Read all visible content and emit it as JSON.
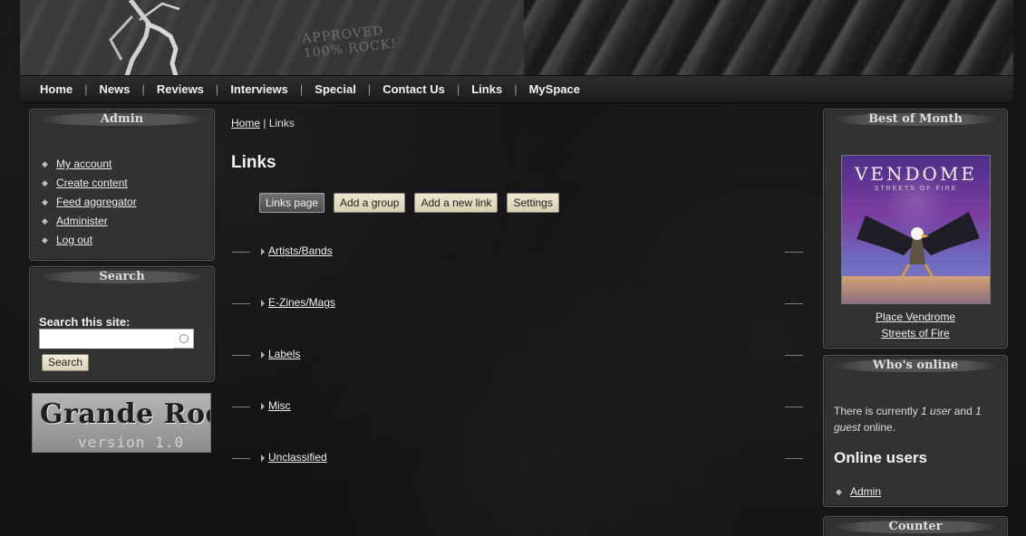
{
  "header": {
    "stamp_line_1": "Approved",
    "stamp_line_2": "100% Rock!"
  },
  "nav": [
    {
      "label": "Home"
    },
    {
      "label": "News"
    },
    {
      "label": "Reviews"
    },
    {
      "label": "Interviews"
    },
    {
      "label": "Special"
    },
    {
      "label": "Contact Us"
    },
    {
      "label": "Links"
    },
    {
      "label": "MySpace"
    }
  ],
  "admin": {
    "title": "Admin",
    "items": [
      {
        "label": "My account"
      },
      {
        "label": "Create content"
      },
      {
        "label": "Feed aggregator"
      },
      {
        "label": "Administer"
      },
      {
        "label": "Log out"
      }
    ]
  },
  "search": {
    "title": "Search",
    "label": "Search this site:",
    "value": "",
    "button_label": "Search"
  },
  "logo": {
    "main": "Grande Rock",
    "version": "version 1.0"
  },
  "main": {
    "breadcrumb": {
      "home": "Home",
      "separator": "|",
      "current": "Links"
    },
    "title": "Links",
    "tabs": [
      {
        "label": "Links page"
      },
      {
        "label": "Add a group"
      },
      {
        "label": "Add a new link"
      },
      {
        "label": "Settings"
      }
    ],
    "groups": [
      {
        "label": "Artists/Bands"
      },
      {
        "label": "E-Zines/Mags"
      },
      {
        "label": "Labels"
      },
      {
        "label": "Misc"
      },
      {
        "label": "Unclassified"
      }
    ]
  },
  "best_of_month": {
    "title": "Best of Month",
    "cover_title": "VENDOME",
    "cover_subtitle": "STREETS OF FIRE",
    "caption_line_1": "Place Vendrome",
    "caption_line_2": "Streets of Fire"
  },
  "online": {
    "title": "Who's online",
    "text_before_users": "There is currently ",
    "users": "1 user",
    "text_between": " and ",
    "guests": "1 guest",
    "text_after": " online.",
    "heading": "Online users",
    "users_list": [
      {
        "label": "Admin"
      }
    ]
  },
  "counter": {
    "title": "Counter"
  },
  "colors": {
    "page_background": "#151515",
    "block_background": "#323232",
    "button_background": "#e3d9bc",
    "active_tab": "#5e5e5e",
    "text": "#f0f0f0"
  },
  "icons": {
    "bullet": "bullet-icon",
    "arrow": "arrow-icon",
    "search": "search-icon"
  }
}
